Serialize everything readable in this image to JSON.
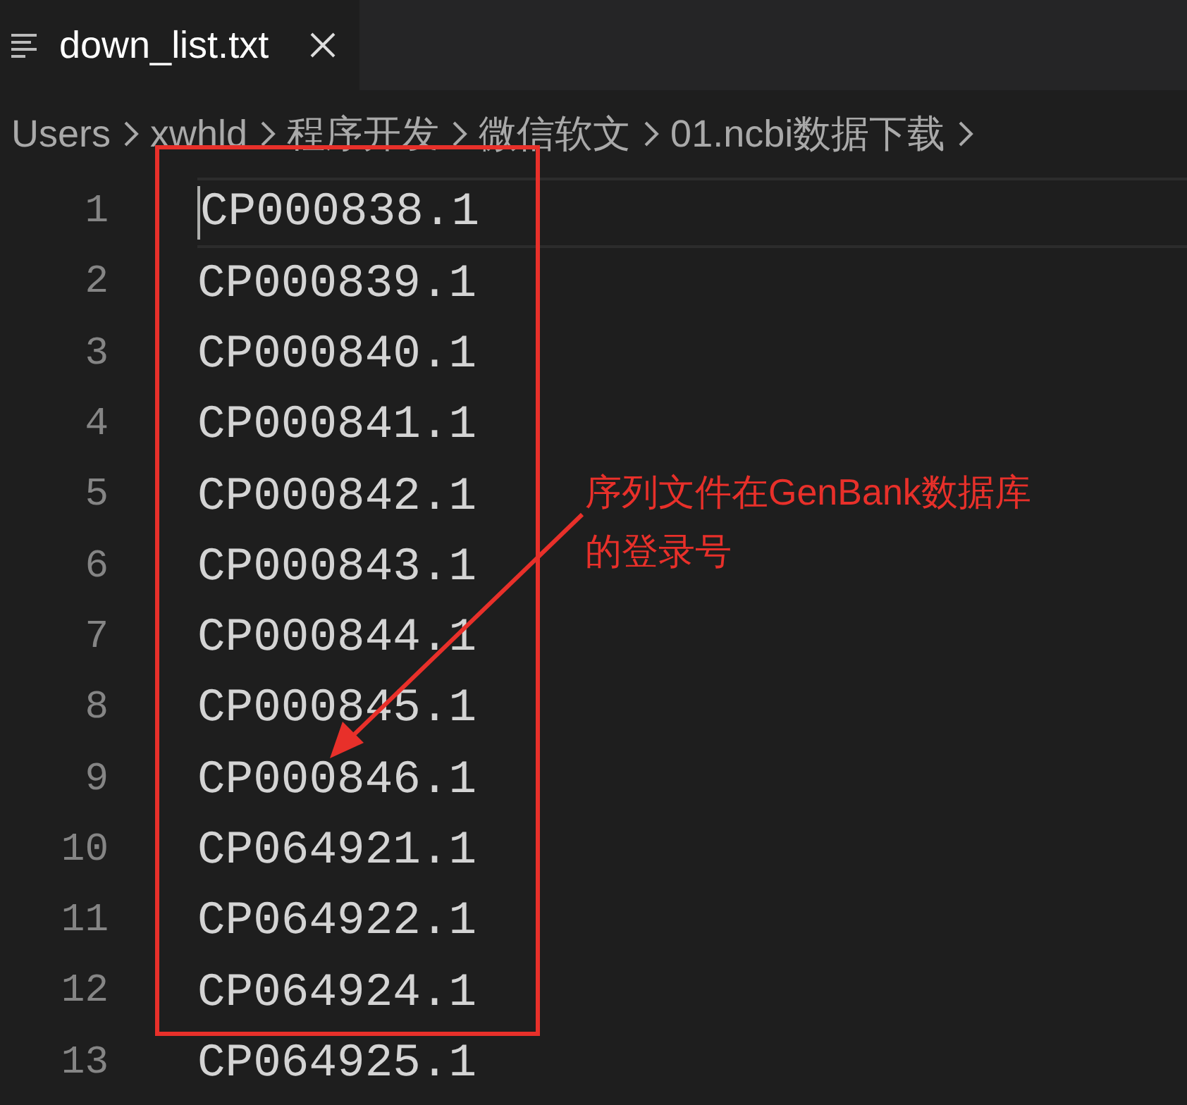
{
  "tab": {
    "title": "down_list.txt",
    "selected": true
  },
  "breadcrumbs": [
    "Users",
    "xwhld",
    "程序开发",
    "微信软文",
    "01.ncbi数据下载"
  ],
  "lines": [
    {
      "number": "1",
      "text": "CP000838.1",
      "current": true
    },
    {
      "number": "2",
      "text": "CP000839.1",
      "current": false
    },
    {
      "number": "3",
      "text": "CP000840.1",
      "current": false
    },
    {
      "number": "4",
      "text": "CP000841.1",
      "current": false
    },
    {
      "number": "5",
      "text": "CP000842.1",
      "current": false
    },
    {
      "number": "6",
      "text": "CP000843.1",
      "current": false
    },
    {
      "number": "7",
      "text": "CP000844.1",
      "current": false
    },
    {
      "number": "8",
      "text": "CP000845.1",
      "current": false
    },
    {
      "number": "9",
      "text": "CP000846.1",
      "current": false
    },
    {
      "number": "10",
      "text": "CP064921.1",
      "current": false
    },
    {
      "number": "11",
      "text": "CP064922.1",
      "current": false
    },
    {
      "number": "12",
      "text": "CP064924.1",
      "current": false
    },
    {
      "number": "13",
      "text": "CP064925.1",
      "current": false
    }
  ],
  "annotation": {
    "lines": [
      "序列文件在GenBank数据库",
      "的登录号"
    ]
  }
}
